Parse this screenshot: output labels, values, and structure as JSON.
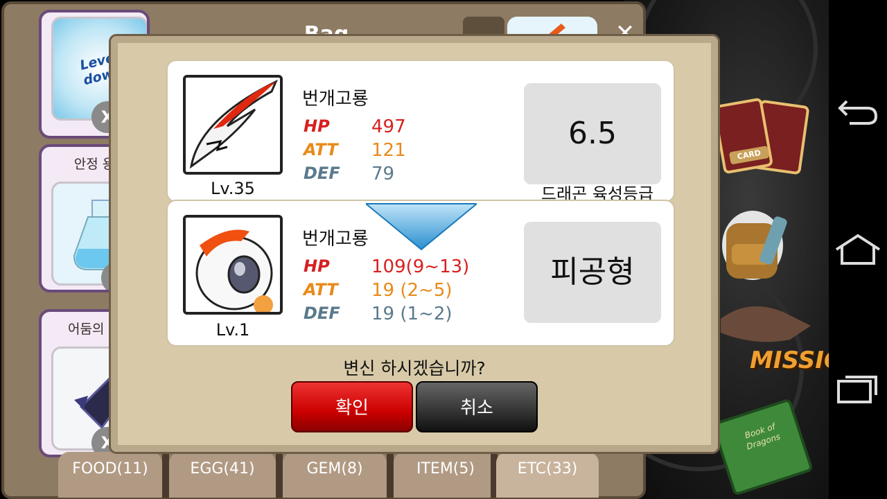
{
  "bag": {
    "title": "Bag",
    "close": "✕",
    "slots": [
      {
        "label": "",
        "item_text": "Level down",
        "remove": "X"
      },
      {
        "label": "안정 용",
        "remove": "X"
      },
      {
        "label": "어둠의 포",
        "remove": "X"
      }
    ],
    "tabs": [
      {
        "label": "FOOD(11)"
      },
      {
        "label": "EGG(41)"
      },
      {
        "label": "GEM(8)"
      },
      {
        "label": "ITEM(5)"
      },
      {
        "label": "ETC(33)"
      }
    ],
    "active_tab": "ETC(33)"
  },
  "dialog": {
    "current": {
      "name": "번개고룡",
      "level": "Lv.35",
      "stats": {
        "hp_label": "HP",
        "hp": "497",
        "att_label": "ATT",
        "att": "121",
        "def_label": "DEF",
        "def": "79"
      },
      "grade_value": "6.5",
      "grade_label": "드래곤 육성등급"
    },
    "result": {
      "name": "번개고룡",
      "level": "Lv.1",
      "stats": {
        "hp_label": "HP",
        "hp": "109(9~13)",
        "att_label": "ATT",
        "att": "19 (2~5)",
        "def_label": "DEF",
        "def": "19 (1~2)"
      },
      "type": "피공형"
    },
    "question": "변신 하시겠습니까?",
    "confirm_label": "확인",
    "cancel_label": "취소"
  },
  "background": {
    "card_label": "CARD",
    "mission_label": "MISSION",
    "book_label": "Book of Dragons"
  },
  "colors": {
    "hp": "#d81f1f",
    "att": "#e88a1a",
    "def": "#5a7a8c",
    "confirm": "#cc0000",
    "cancel": "#333333"
  },
  "icons": {
    "nav_back": "back-icon",
    "nav_home": "home-icon",
    "nav_recent": "recent-apps-icon"
  }
}
